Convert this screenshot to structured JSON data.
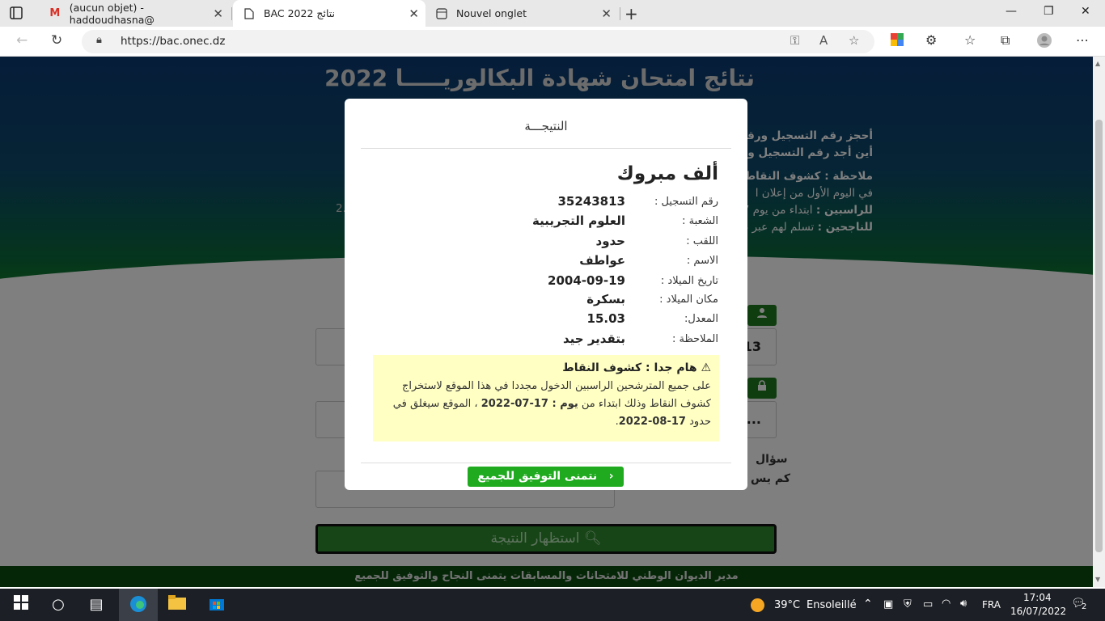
{
  "browser": {
    "tabs": [
      {
        "title": "(aucun objet) - haddoudhasna@",
        "icon": "gmail-icon"
      },
      {
        "title": "BAC 2022 نتائج",
        "icon": "page-icon"
      },
      {
        "title": "Nouvel onglet",
        "icon": "newtab-icon"
      }
    ],
    "url": "https://bac.onec.dz"
  },
  "page": {
    "title": "نتائج امتحان شهادة البكالوريـــــا 2022",
    "info": [
      {
        "bold": "أحجز رقم التسجيل ورقمك",
        "rest": ""
      },
      {
        "bold": "أين أجد رقم التسجيل والر",
        "rest": ""
      },
      {
        "bold": "ملاحظة : كشوف النقاط",
        "rest": ""
      },
      {
        "bold": "",
        "rest": "في اليوم الأول من إعلان ا"
      },
      {
        "bold": "للراسبين :",
        "rest": " ابتداء من يوم 7"
      },
      {
        "bold": "للناجحين :",
        "rest": " تسلم لهم عبر م"
      }
    ],
    "stray_text": "2.",
    "field1_value": "13",
    "field2_value": "...",
    "question1": "سؤال",
    "question2": "كم يس",
    "submit_label": "استظهار النتيجة",
    "footer": "مدير الديوان الوطني للامتحانات والمسابقات يتمنى النجاح والتوفيق للجميع"
  },
  "modal": {
    "header": "النتيجـــة",
    "congrats": "ألف مبروك",
    "rows": [
      {
        "label": "رقم التسجيل :",
        "value": "35243813"
      },
      {
        "label": "الشعبة :",
        "value": "العلوم التجريبية"
      },
      {
        "label": "اللقب :",
        "value": "حدود"
      },
      {
        "label": "الاسم :",
        "value": "عواطف"
      },
      {
        "label": "تاريخ الميلاد :",
        "value": "2004-09-19"
      },
      {
        "label": "مكان الميلاد :",
        "value": "بسكرة"
      },
      {
        "label": "المعدل:",
        "value": "15.03"
      },
      {
        "label": "الملاحظة :",
        "value": "بتقدير جيد"
      }
    ],
    "notice_title": "هام جدا : كشوف النقاط",
    "notice_body_1": "على جميع المترشحين الراسبين الدخول مجددا في هذا الموقع لاستخراج كشوف النقاط وذلك ابتداء من ",
    "notice_bold_1": "يوم : 17-07-2022",
    "notice_body_2": " ، الموقع سيغلق في حدود ",
    "notice_bold_2": "17-08-2022",
    "notice_body_3": ".",
    "button": "نتمنى التوفيق للجميع"
  },
  "taskbar": {
    "temperature": "39°C",
    "weather": "Ensoleillé",
    "language": "FRA",
    "time": "17:04",
    "date": "16/07/2022",
    "notifications": "2"
  },
  "colors": {
    "header_blue": "#0c3a73",
    "green": "#188a1c",
    "button_green": "#1faa1f",
    "notice_yellow": "#ffffc4"
  }
}
